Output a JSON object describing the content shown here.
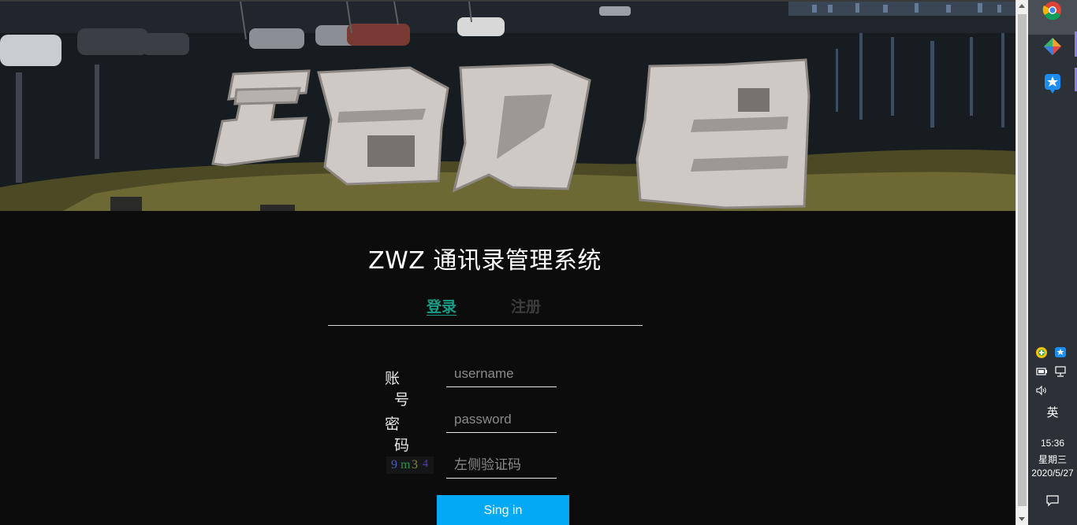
{
  "app": {
    "title": "ZWZ 通讯录管理系统"
  },
  "tabs": [
    {
      "label": "登录",
      "active": true
    },
    {
      "label": "注册",
      "active": false
    }
  ],
  "form": {
    "account_label_1": "账",
    "account_label_2": "号",
    "account_placeholder": "username",
    "password_label_1": "密",
    "password_label_2": "码",
    "password_placeholder": "password",
    "captcha_text": "9m34",
    "captcha_placeholder": "左侧验证码",
    "submit_label": "Sing in"
  },
  "colors": {
    "accent_tab": "#169e86",
    "button": "#03a9f4",
    "background": "#0c0c0c"
  },
  "taskbar": {
    "pinned": [
      "chrome-icon",
      "app-diamond-icon",
      "app-star-icon"
    ],
    "tray": [
      "security-icon",
      "app-star-tray-icon",
      "battery-icon",
      "network-icon",
      "volume-icon"
    ],
    "ime": "英",
    "time": "15:36",
    "weekday": "星期三",
    "date": "2020/5/27"
  }
}
